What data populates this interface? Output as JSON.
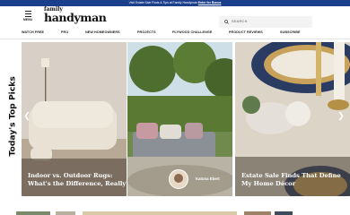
{
  "promo": {
    "text": "Visit Estate Sale Finds & Tips at Family Handyman",
    "link": "Enter for Bonus"
  },
  "header": {
    "menu_label": "MENU",
    "logo_line1": "family",
    "logo_line2": "handyman",
    "search_placeholder": "SEARCH"
  },
  "nav": {
    "items": [
      {
        "label": "WATCH FREE"
      },
      {
        "label": "PRO"
      },
      {
        "label": "NEW HOMEOWNERS"
      },
      {
        "label": "PROJECTS"
      },
      {
        "label": "PLYWOOD CHALLENGE"
      },
      {
        "label": "PRODUCT REVIEWS"
      },
      {
        "label": "SUBSCRIBE"
      }
    ]
  },
  "section": {
    "heading": "Today's Top Picks"
  },
  "cards": [
    {
      "title": "Indoor vs. Outdoor Rugs: What's the Difference, Really?"
    },
    {
      "author": "Katuna Ebert"
    },
    {
      "title": "Estate Sale Finds That Define My Home Décor"
    }
  ],
  "colors": {
    "promo_bg": "#1c3f8c",
    "accent": "#1c3f8c"
  }
}
